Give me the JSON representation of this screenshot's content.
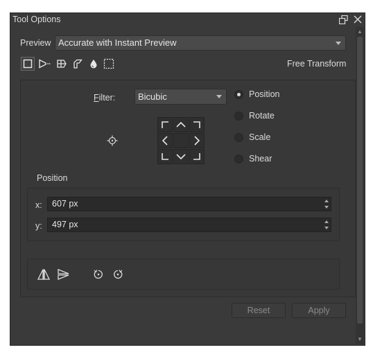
{
  "window": {
    "title": "Tool Options",
    "float_icon": "float-window-icon",
    "close_icon": "close-icon"
  },
  "preview": {
    "label": "Preview",
    "value": "Accurate with Instant Preview"
  },
  "toolbar": {
    "mode_label": "Free Transform",
    "tools": [
      {
        "name": "free-transform-icon",
        "active": true
      },
      {
        "name": "perspective-transform-icon",
        "active": false
      },
      {
        "name": "warp-transform-icon",
        "active": false
      },
      {
        "name": "cage-transform-icon",
        "active": false
      },
      {
        "name": "liquify-transform-icon",
        "active": false
      },
      {
        "name": "mesh-transform-icon",
        "active": false
      }
    ]
  },
  "filter": {
    "label": "Filter:",
    "value": "Bicubic"
  },
  "modes": [
    {
      "label": "Position",
      "checked": true
    },
    {
      "label": "Rotate",
      "checked": false
    },
    {
      "label": "Scale",
      "checked": false
    },
    {
      "label": "Shear",
      "checked": false
    }
  ],
  "anchor_grid": [
    "top-left",
    "top",
    "top-right",
    "left",
    "center",
    "right",
    "bottom-left",
    "bottom",
    "bottom-right"
  ],
  "position": {
    "heading": "Position",
    "x_label": "x:",
    "x_value": "607 px",
    "y_label": "y:",
    "y_value": "497 px"
  },
  "buttons": {
    "reset": "Reset",
    "apply": "Apply"
  }
}
